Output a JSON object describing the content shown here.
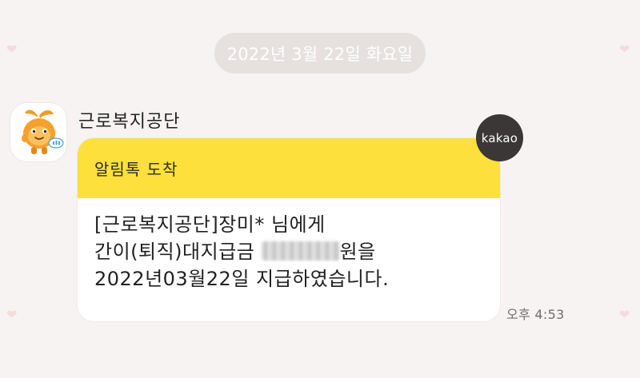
{
  "chat": {
    "date_separator": "2022년 3월 22일 화요일",
    "sender": {
      "name": "근로복지공단",
      "avatar_icon": "mascot-icon"
    },
    "message": {
      "header_title": "알림톡 도착",
      "line1": "[근로복지공단]장미* 님에게",
      "line2_prefix": "간이(퇴직)대지급금 ",
      "line2_suffix": "원을",
      "line3": "2022년03월22일 지급하였습니다.",
      "time": "오후 4:53"
    },
    "badge": {
      "label": "kakao"
    }
  },
  "colors": {
    "background": "#f6f3f2",
    "header_yellow": "#fde03b",
    "badge_bg": "#3a3736"
  }
}
